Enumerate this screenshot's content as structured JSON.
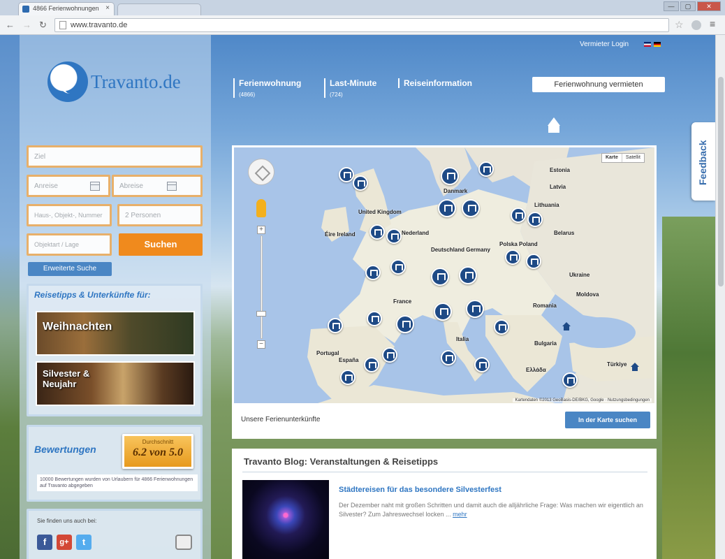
{
  "browser": {
    "tab_title": "4866 Ferienwohnungen",
    "tab2_title": "",
    "url": "www.travanto.de",
    "window_buttons": [
      "—",
      "▢",
      "✕"
    ]
  },
  "header": {
    "login_link": "Vermieter Login",
    "nav": [
      {
        "label": "Ferienwohnung",
        "sub": "(4866)"
      },
      {
        "label": "Last-Minute",
        "sub": "(724)"
      },
      {
        "label": "Reiseinformation",
        "sub": ""
      }
    ],
    "rent_button": "Ferienwohnung vermieten",
    "feedback": "Feedback"
  },
  "logo": {
    "text": "Travanto.de"
  },
  "search": {
    "destination_placeholder": "Ziel",
    "arrival_placeholder": "Anreise",
    "departure_placeholder": "Abreise",
    "keyword_placeholder": "Haus-, Objekt-, Nummer",
    "persons_placeholder": "2 Personen",
    "category_placeholder": "Objektart / Lage",
    "search_button": "Suchen",
    "advanced_button": "Erweiterte Suche"
  },
  "tips": {
    "title": "Reisetipps & Unterkünfte für:",
    "tiles": [
      "Weihnachten",
      "Silvester & Neujahr"
    ]
  },
  "reviews": {
    "title": "Bewertungen",
    "badge_caption": "Durchschnitt",
    "badge_score": "6.2 von 5.0",
    "note": "10000 Bewertungen wurden von Urlaubern für 4866 Ferienwohnungen auf Travanto abgegeben"
  },
  "social": {
    "title": "Sie finden uns auch bei:",
    "icons": [
      "f",
      "g+",
      "t"
    ]
  },
  "map": {
    "type_buttons": [
      "Karte",
      "Satellit"
    ],
    "credits": "Kartendaten ©2013 GeoBasis-DE/BKG, Google · Nutzungsbedingungen",
    "labels": [
      "Estonia",
      "Latvia",
      "Lithuania",
      "Belarus",
      "United Kingdom",
      "Éire Ireland",
      "Nederland",
      "Polska Poland",
      "Deutschland Germany",
      "Ukraine",
      "France",
      "Moldova",
      "Romania",
      "Bulgaria",
      "Portugal",
      "España",
      "Italia",
      "Türkiye",
      "Ελλάδα",
      "Danmark"
    ],
    "footer_text": "Unsere Ferienunterkünfte",
    "search_button": "In der Karte suchen"
  },
  "blog": {
    "section_title": "Travanto Blog: Veranstaltungen & Reisetipps",
    "post_title": "Städtereisen für das besondere Silvesterfest",
    "post_text": "Der Dezember naht mit großen Schritten und damit auch die alljährliche Frage: Was machen wir eigentlich an Silvester? Zum Jahreswechsel locken ...",
    "more": "mehr"
  }
}
